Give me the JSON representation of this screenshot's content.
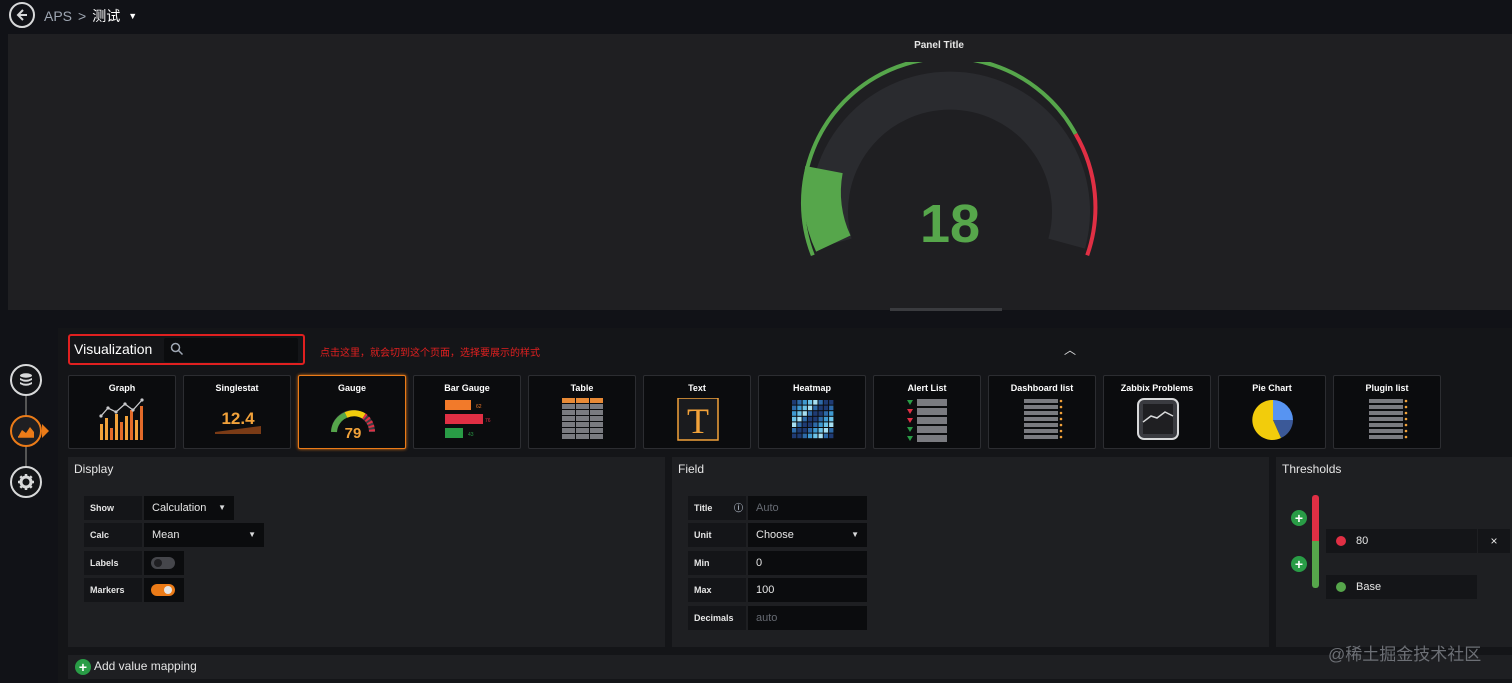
{
  "breadcrumb": {
    "parent": "APS",
    "separator": ">",
    "current": "测试"
  },
  "panel": {
    "title": "Panel Title",
    "gauge_value": "18",
    "gauge_min": 0,
    "gauge_max": 100,
    "threshold": 80
  },
  "visualization": {
    "label": "Visualization",
    "search_placeholder": "",
    "annotation": "点击这里，就会切到这个页面，选择要展示的样式",
    "cards": [
      {
        "name": "Graph",
        "icon": "graph-icon"
      },
      {
        "name": "Singlestat",
        "icon": "singlestat-icon",
        "sample": "12.4"
      },
      {
        "name": "Gauge",
        "icon": "gauge-icon",
        "sample": "79",
        "selected": true
      },
      {
        "name": "Bar Gauge",
        "icon": "bar-gauge-icon",
        "samples": [
          "62",
          "76",
          "43"
        ]
      },
      {
        "name": "Table",
        "icon": "table-icon"
      },
      {
        "name": "Text",
        "icon": "text-icon",
        "glyph": "T"
      },
      {
        "name": "Heatmap",
        "icon": "heatmap-icon"
      },
      {
        "name": "Alert List",
        "icon": "alert-list-icon"
      },
      {
        "name": "Dashboard list",
        "icon": "dashboard-list-icon"
      },
      {
        "name": "Zabbix Problems",
        "icon": "zabbix-problems-icon"
      },
      {
        "name": "Pie Chart",
        "icon": "pie-chart-icon"
      },
      {
        "name": "Plugin list",
        "icon": "plugin-list-icon"
      }
    ]
  },
  "display": {
    "header": "Display",
    "show_label": "Show",
    "show_value": "Calculation",
    "calc_label": "Calc",
    "calc_value": "Mean",
    "labels_label": "Labels",
    "labels_on": false,
    "markers_label": "Markers",
    "markers_on": true
  },
  "field": {
    "header": "Field",
    "title_label": "Title",
    "title_placeholder": "Auto",
    "unit_label": "Unit",
    "unit_value": "Choose",
    "min_label": "Min",
    "min_value": "0",
    "max_label": "Max",
    "max_value": "100",
    "decimals_label": "Decimals",
    "decimals_placeholder": "auto"
  },
  "thresholds": {
    "header": "Thresholds",
    "items": [
      {
        "value": "80",
        "color": "#e02f44",
        "remove": "×"
      },
      {
        "value": "Base",
        "color": "#56a64b"
      }
    ]
  },
  "value_mapping": {
    "label": "Add value mapping"
  },
  "watermark": "@稀土掘金技术社区",
  "colors": {
    "accent": "#eb7b18",
    "ok": "#56a64b",
    "danger": "#e02f44",
    "annotation": "#e02020"
  }
}
